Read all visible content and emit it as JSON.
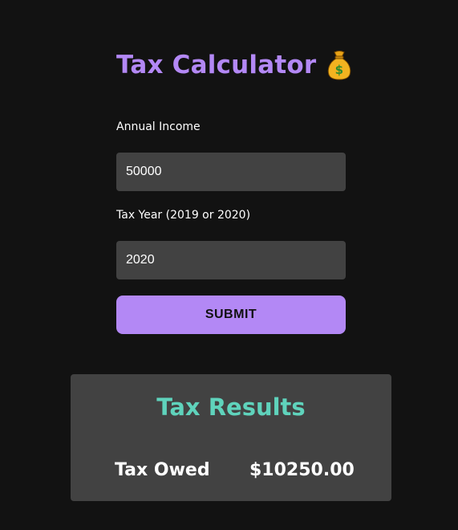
{
  "app": {
    "title": "Tax Calculator",
    "title_icon": "money-bag-icon"
  },
  "form": {
    "income": {
      "label": "Annual Income",
      "value": "50000"
    },
    "year": {
      "label": "Tax Year (2019 or 2020)",
      "value": "2020"
    },
    "submit_label": "SUBMIT"
  },
  "results": {
    "title": "Tax Results",
    "owed_label": "Tax Owed",
    "owed_value": "$10250.00"
  },
  "colors": {
    "background": "#121212",
    "accent": "#b388f5",
    "results_title": "#5fd3bc",
    "panel": "#424242"
  }
}
